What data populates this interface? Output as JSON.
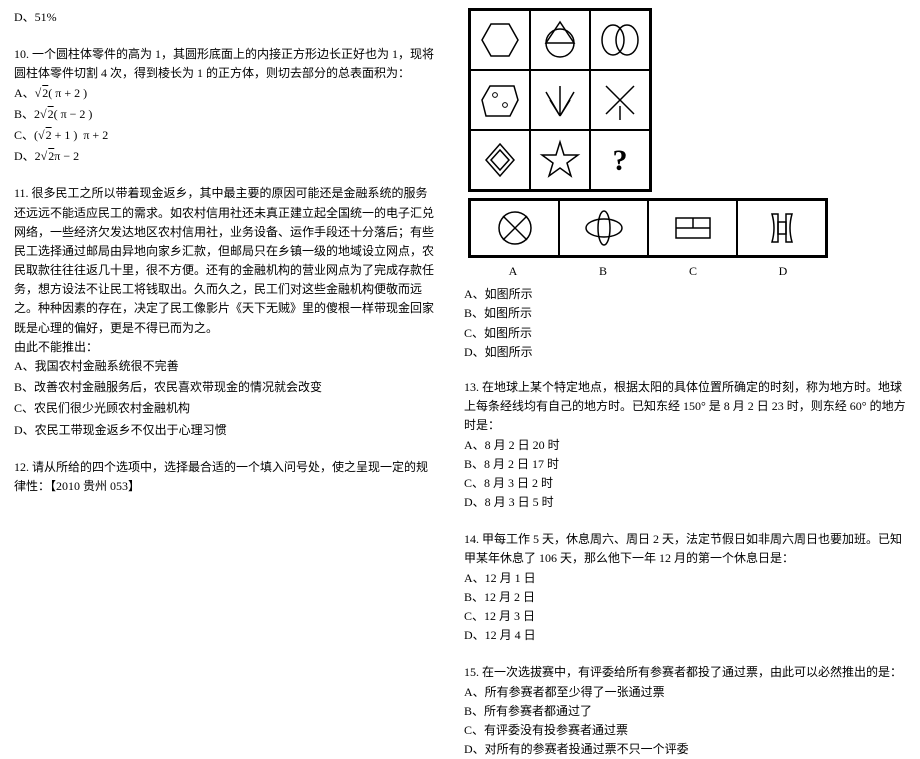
{
  "left": {
    "hdr": "D、51%",
    "q10": {
      "text": "10. 一个圆柱体零件的高为 1，其圆形底面上的内接正方形边长正好也为 1，现将圆柱体零件切割 4 次，得到棱长为 1 的正方体，则切去部分的总表面积为：",
      "opts": [
        "A、√2 ( π + 2 )",
        "B、2√2 ( π − 2 )",
        "C、( √2 + 1 ) π + 2",
        "D、2√2 π − 2"
      ]
    },
    "q11": {
      "text": "11. 很多民工之所以带着现金返乡，其中最主要的原因可能还是金融系统的服务还远远不能适应民工的需求。如农村信用社还未真正建立起全国统一的电子汇兑网络，一些经济欠发达地区农村信用社，业务设备、运作手段还十分落后；有些民工选择通过邮局由异地向家乡汇款，但邮局只在乡镇一级的地域设立网点，农民取款往往往返几十里，很不方便。还有的金融机构的营业网点为了完成存款任务，想方设法不让民工将钱取出。久而久之，民工们对这些金融机构便敬而远之。种种因素的存在，决定了民工像影片《天下无贼》里的傻根一样带现金回家既是心理的偏好，更是不得已而为之。",
      "stem": "由此不能推出：",
      "opts": [
        "A、我国农村金融系统很不完善",
        "B、改善农村金融服务后，农民喜欢带现金的情况就会改变",
        "C、农民们很少光顾农村金融机构",
        "D、农民工带现金返乡不仅出于心理习惯"
      ]
    },
    "q12": "12. 请从所给的四个选项中，选择最合适的一个填入问号处，使之呈现一定的规律性：【2010 贵州 053】"
  },
  "right": {
    "q12opts": [
      "A、如图所示",
      "B、如图所示",
      "C、如图所示",
      "D、如图所示"
    ],
    "labels": [
      "A",
      "B",
      "C",
      "D"
    ],
    "q13": {
      "text": "13. 在地球上某个特定地点，根据太阳的具体位置所确定的时刻，称为地方时。地球上每条经线均有自己的地方时。已知东经 150° 是 8 月 2 日 23 时，则东经 60° 的地方时是：",
      "opts": [
        "A、8 月 2 日 20 时",
        "B、8 月 2 日 17 时",
        "C、8 月 3 日 2 时",
        "D、8 月 3 日 5 时"
      ]
    },
    "q14": {
      "text": "14. 甲每工作 5 天，休息周六、周日 2 天，法定节假日如非周六周日也要加班。已知甲某年休息了 106 天，那么他下一年 12 月的第一个休息日是：",
      "opts": [
        "A、12 月 1 日",
        "B、12 月 2 日",
        "C、12 月 3 日",
        "D、12 月 4 日"
      ]
    },
    "q15": {
      "text": "15. 在一次选拔赛中，有评委给所有参赛者都投了通过票，由此可以必然推出的是：",
      "opts": [
        "A、所有参赛者都至少得了一张通过票",
        "B、所有参赛者都通过了",
        "C、有评委没有投参赛者通过票",
        "D、对所有的参赛者投通过票不只一个评委"
      ]
    }
  }
}
